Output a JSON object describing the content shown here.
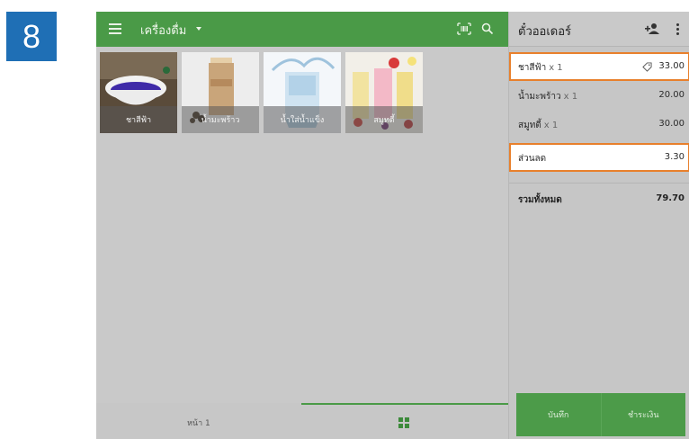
{
  "step_badge": "8",
  "topbar": {
    "category_title": "เครื่องดื่ม",
    "menu_icon": "hamburger-icon",
    "barcode_icon": "barcode-scan-icon",
    "search_icon": "search-icon",
    "color": "#4a9a47"
  },
  "items": [
    {
      "label": "ชาสีฟ้า"
    },
    {
      "label": "น้ำมะพร้าว"
    },
    {
      "label": "น้ำใส่น้ำแข็ง"
    },
    {
      "label": "สมูทตี้"
    }
  ],
  "bottom_bar": {
    "page_label": "หน้า 1",
    "grid_icon": "grid-icon"
  },
  "ticket": {
    "title": "ตั๋วออเดอร์",
    "add_customer_icon": "add-customer-icon",
    "more_icon": "more-vert-icon",
    "lines": [
      {
        "name": "ชาสีฟ้า",
        "qty": "x 1",
        "amount": "33.00",
        "discount_tag": true
      },
      {
        "name": "น้ำมะพร้าว",
        "qty": "x 1",
        "amount": "20.00"
      },
      {
        "name": "สมูทตี้",
        "qty": "x 1",
        "amount": "30.00"
      }
    ],
    "discount": {
      "name": "ส่วนลด",
      "amount": "3.30"
    },
    "total": {
      "label": "รวมทั้งหมด",
      "amount": "79.70"
    },
    "save_label": "บันทึก",
    "charge_label": "ชำระเงิน",
    "highlight_color": "#e8802c"
  }
}
